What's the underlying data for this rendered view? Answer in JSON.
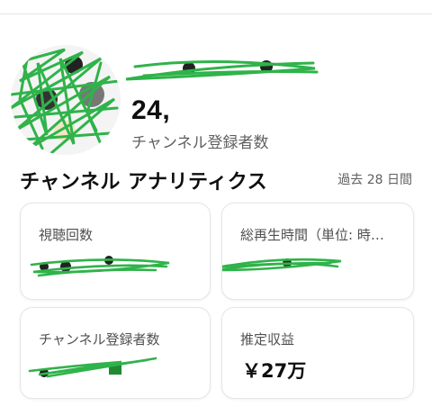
{
  "channel": {
    "subscriber_count_visible": "24,",
    "subscriber_label": "チャンネル登録者数"
  },
  "analytics": {
    "title": "チャンネル アナリティクス",
    "period": "過去 28 日間"
  },
  "cards": {
    "views": {
      "label": "視聴回数"
    },
    "watch_time": {
      "label": "総再生時間（単位: 時…"
    },
    "subscribers": {
      "label": "チャンネル登録者数"
    },
    "revenue": {
      "label": "推定収益",
      "value": "￥27万"
    }
  },
  "colors": {
    "redaction_green": "#2fb34a",
    "text_primary": "#0f0f0f",
    "text_secondary": "#606060"
  }
}
